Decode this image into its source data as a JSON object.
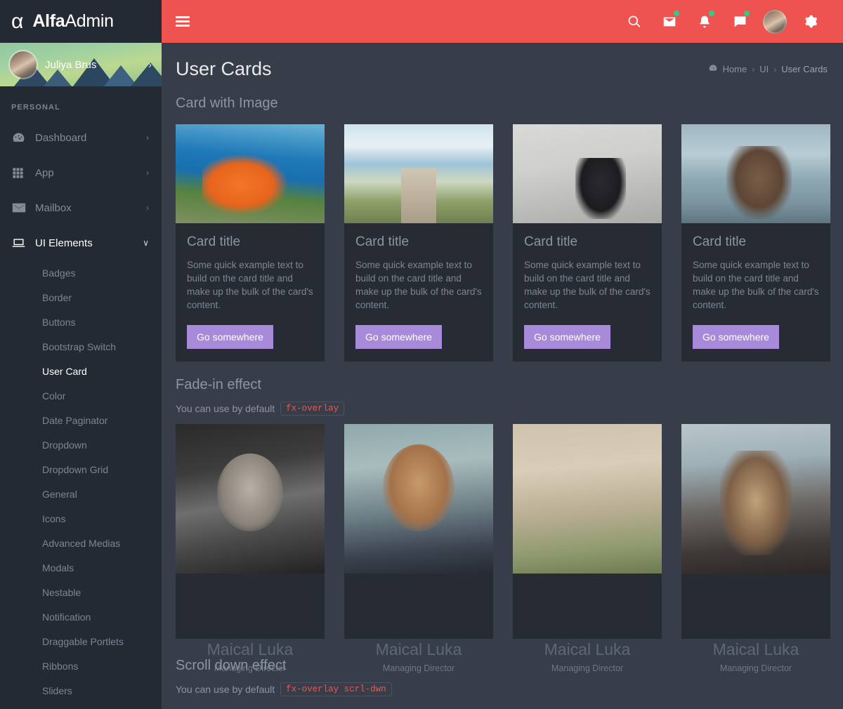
{
  "brand": {
    "logo_icon": "alpha-logo-icon",
    "name_bold": "Alfa",
    "name_light": "Admin"
  },
  "topbar": {
    "menu_toggle": "hamburger-menu-icon",
    "icons": [
      {
        "name": "search-icon",
        "badge": false
      },
      {
        "name": "mail-icon",
        "badge": true
      },
      {
        "name": "bell-icon",
        "badge": true
      },
      {
        "name": "chat-icon",
        "badge": true
      }
    ],
    "avatar": "user-avatar",
    "settings": "gear-icon",
    "bg_color": "#ef5350",
    "badge_color": "#2ecc87"
  },
  "sidebar": {
    "profile": {
      "name": "Juliya Brus",
      "chevron": "›"
    },
    "section_label": "PERSONAL",
    "items": [
      {
        "label": "Dashboard",
        "icon": "speedometer-icon",
        "chevron": "›",
        "active": false
      },
      {
        "label": "App",
        "icon": "grid-icon",
        "chevron": "›",
        "active": false
      },
      {
        "label": "Mailbox",
        "icon": "envelope-icon",
        "chevron": "›",
        "active": false
      },
      {
        "label": "UI Elements",
        "icon": "laptop-icon",
        "chevron": "∨",
        "active": true
      }
    ],
    "sub_items": [
      {
        "label": "Badges",
        "active": false
      },
      {
        "label": "Border",
        "active": false
      },
      {
        "label": "Buttons",
        "active": false
      },
      {
        "label": "Bootstrap Switch",
        "active": false
      },
      {
        "label": "User Card",
        "active": true
      },
      {
        "label": "Color",
        "active": false
      },
      {
        "label": "Date Paginator",
        "active": false
      },
      {
        "label": "Dropdown",
        "active": false
      },
      {
        "label": "Dropdown Grid",
        "active": false
      },
      {
        "label": "General",
        "active": false
      },
      {
        "label": "Icons",
        "active": false
      },
      {
        "label": "Advanced Medias",
        "active": false
      },
      {
        "label": "Modals",
        "active": false
      },
      {
        "label": "Nestable",
        "active": false
      },
      {
        "label": "Notification",
        "active": false
      },
      {
        "label": "Draggable Portlets",
        "active": false
      },
      {
        "label": "Ribbons",
        "active": false
      },
      {
        "label": "Sliders",
        "active": false
      }
    ]
  },
  "page": {
    "title": "User Cards",
    "breadcrumb": {
      "home": "Home",
      "sep": "›",
      "middle": "UI",
      "current": "User Cards",
      "icon": "home-dashboard-icon"
    }
  },
  "sections": {
    "card_with_image": {
      "title": "Card with Image"
    },
    "fade_in": {
      "title": "Fade-in effect",
      "note": "You can use by default",
      "code": "fx-overlay"
    },
    "scroll_down": {
      "title": "Scroll down effect",
      "note": "You can use by default",
      "code": "fx-overlay scrl-dwn"
    }
  },
  "image_cards": [
    {
      "title": "Card title",
      "text": "Some quick example text to build on the card title and make up the bulk of the card's content.",
      "button": "Go somewhere",
      "photo": "coiled-orange-rope-on-pier"
    },
    {
      "title": "Card title",
      "text": "Some quick example text to build on the card title and make up the bulk of the card's content.",
      "button": "Go somewhere",
      "photo": "wooden-boardwalk-to-beach"
    },
    {
      "title": "Card title",
      "text": "Some quick example text to build on the card title and make up the bulk of the card's content.",
      "button": "Go somewhere",
      "photo": "woman-sitting-on-wall"
    },
    {
      "title": "Card title",
      "text": "Some quick example text to build on the card title and make up the bulk of the card's content.",
      "button": "Go somewhere",
      "photo": "woman-with-camera-at-sea"
    }
  ],
  "user_cards": [
    {
      "name": "Maical Luka",
      "role": "Managing Director",
      "photo": "smiling-man-bw-portrait"
    },
    {
      "name": "Maical Luka",
      "role": "Managing Director",
      "photo": "red-haired-woman-portrait"
    },
    {
      "name": "Maical Luka",
      "role": "Managing Director",
      "photo": "woman-with-glasses-denim"
    },
    {
      "name": "Maical Luka",
      "role": "Managing Director",
      "photo": "man-with-hat-and-backpack"
    }
  ],
  "theme": {
    "page_bg": "#383e49",
    "card_bg": "#272b33",
    "sidebar_bg": "#242a33",
    "accent_red": "#ef5350",
    "button_purple": "#a78bda",
    "code_red": "#e05b5b"
  }
}
